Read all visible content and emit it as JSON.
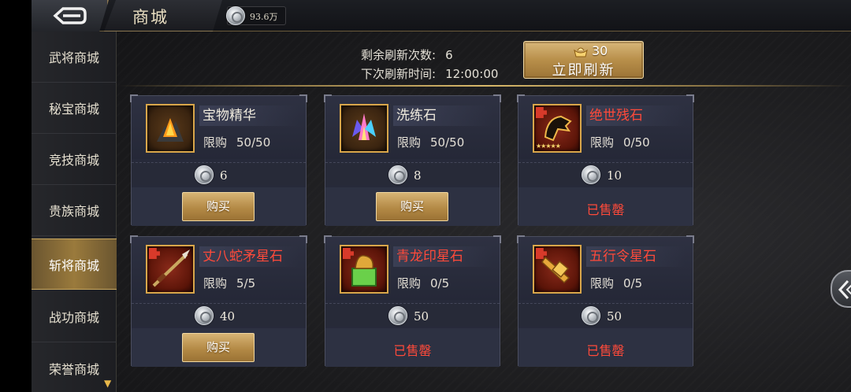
{
  "header": {
    "title": "商城",
    "currency_amount": "93.6万"
  },
  "sidebar": {
    "items": [
      {
        "label": "武将商城",
        "active": false
      },
      {
        "label": "秘宝商城",
        "active": false
      },
      {
        "label": "竞技商城",
        "active": false
      },
      {
        "label": "贵族商城",
        "active": false
      },
      {
        "label": "斩将商城",
        "active": true
      },
      {
        "label": "战功商城",
        "active": false
      },
      {
        "label": "荣誉商城",
        "active": false
      }
    ]
  },
  "refresh": {
    "remaining_label": "剩余刷新次数:",
    "remaining_value": "6",
    "next_label": "下次刷新时间:",
    "next_value": "12:00:00",
    "cost": "30",
    "button_label": "立即刷新"
  },
  "shop": {
    "items": [
      {
        "name": "宝物精华",
        "name_color": "white",
        "limit_label": "限购",
        "limit": "50/50",
        "price": "6",
        "action": "购买",
        "sold_out": false,
        "icon": "treasure-essence-icon"
      },
      {
        "name": "洗练石",
        "name_color": "white",
        "limit_label": "限购",
        "limit": "50/50",
        "price": "8",
        "action": "购买",
        "sold_out": false,
        "icon": "refining-stone-icon"
      },
      {
        "name": "绝世残石",
        "name_color": "red",
        "limit_label": "限购",
        "limit": "0/50",
        "price": "10",
        "action": "已售罄",
        "sold_out": true,
        "icon": "peerless-fragment-icon"
      },
      {
        "name": "丈八蛇矛星石",
        "name_color": "red",
        "limit_label": "限购",
        "limit": "5/5",
        "price": "40",
        "action": "购买",
        "sold_out": false,
        "icon": "serpent-spear-icon"
      },
      {
        "name": "青龙印星石",
        "name_color": "red",
        "limit_label": "限购",
        "limit": "0/5",
        "price": "50",
        "action": "已售罄",
        "sold_out": true,
        "icon": "dragon-seal-icon"
      },
      {
        "name": "五行令星石",
        "name_color": "red",
        "limit_label": "限购",
        "limit": "0/5",
        "price": "50",
        "action": "已售罄",
        "sold_out": true,
        "icon": "five-elements-token-icon"
      }
    ]
  },
  "colors": {
    "accent_gold": "#c9a860",
    "sold_out_red": "#ff4a3a",
    "card_bg": "#272a3a"
  }
}
